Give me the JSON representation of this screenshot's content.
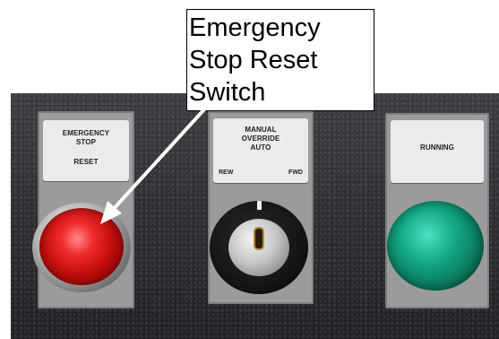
{
  "callout": {
    "line1": "Emergency",
    "line2": "Stop Reset",
    "line3": "Switch"
  },
  "panel": {
    "left_legend": {
      "line1": "EMERGENCY",
      "line2": "STOP",
      "line3": "RESET"
    },
    "middle_legend": {
      "line1": "MANUAL",
      "line2": "OVERRIDE",
      "line3": "AUTO",
      "left": "REW",
      "right": "FWD"
    },
    "right_legend": {
      "line1": "RUNNING"
    }
  },
  "colors": {
    "panel": "#2a2c2f",
    "red_button": "#d81010",
    "green_button": "#0a8a6a",
    "legend_plate": "#e9ece9",
    "arrow": "#ffffff"
  }
}
